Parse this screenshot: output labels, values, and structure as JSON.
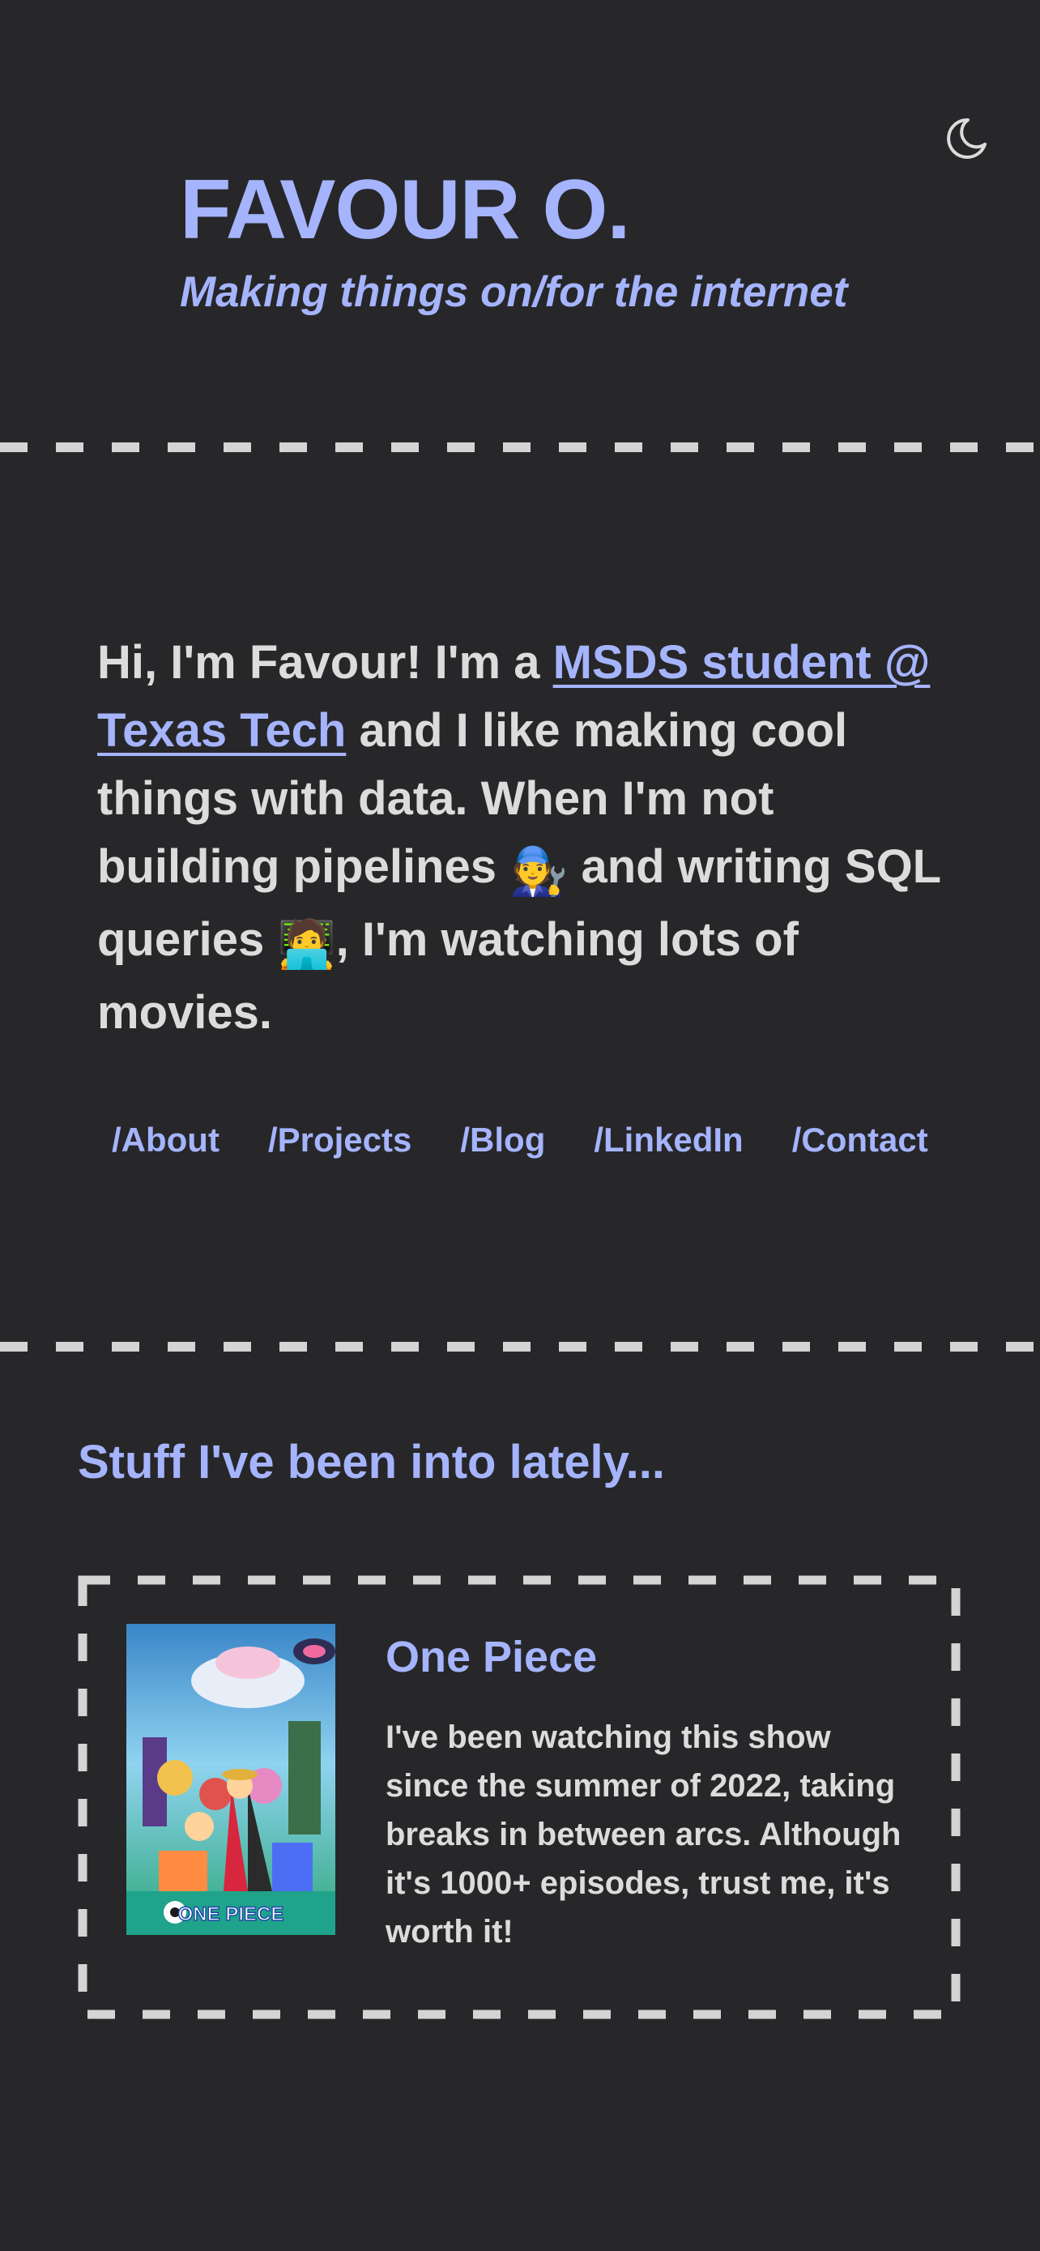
{
  "header": {
    "title": "FAVOUR O.",
    "tagline": "Making things on/for the internet",
    "theme_toggle_icon": "moon-icon"
  },
  "intro": {
    "prefix": "Hi, I'm Favour! I'm a ",
    "link_text": "MSDS student @ Texas Tech",
    "middle": " and I like making cool things with data. When I'm not building pipelines ",
    "emoji_mechanic": "🧑‍🔧",
    "middle2": " and writing SQL queries ",
    "emoji_technologist": "🧑‍💻",
    "suffix": ", I'm watching lots of movies."
  },
  "nav": {
    "items": [
      "/About",
      "/Projects",
      "/Blog",
      "/LinkedIn",
      "/Contact"
    ]
  },
  "lately": {
    "heading": "Stuff I've been into lately...",
    "card": {
      "title": "One Piece",
      "description": "I've been watching this show since the summer of 2022, taking breaks in between arcs. Although it's 1000+ episodes, trust me, it's worth it!",
      "poster_logo_text": "ONE PIECE"
    }
  },
  "colors": {
    "background": "#27272a",
    "accent": "#a5b4fc",
    "text": "#dcdcdc",
    "divider": "#d4d4d4"
  }
}
